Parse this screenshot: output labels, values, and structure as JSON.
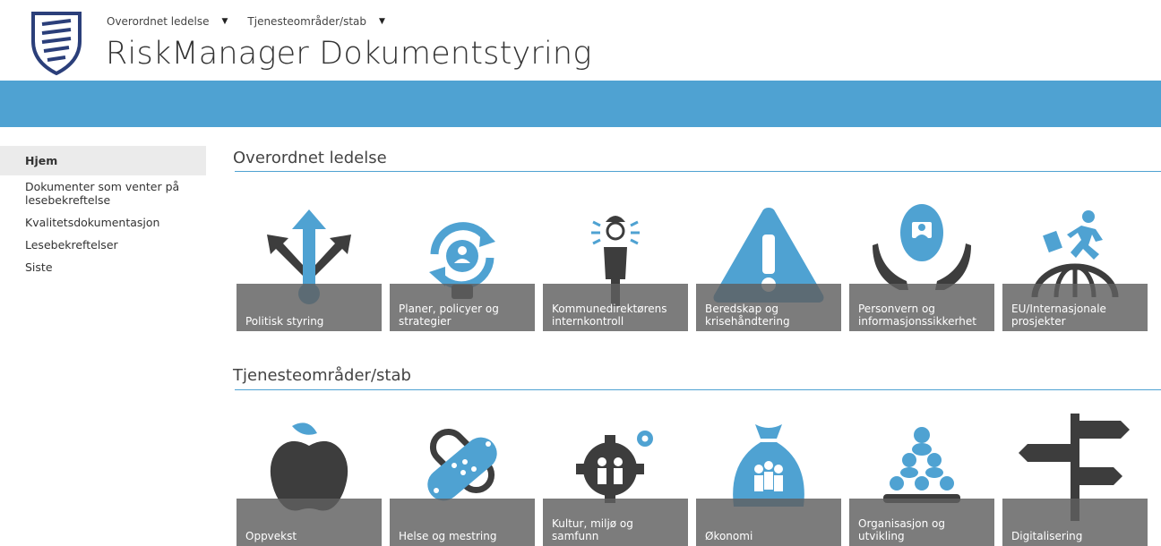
{
  "header": {
    "nav": [
      "Overordnet ledelse",
      "Tjenesteområder/stab"
    ],
    "title": "RiskManager Dokumentstyring"
  },
  "sidebar": {
    "items": [
      {
        "label": "Hjem",
        "active": true
      },
      {
        "label": "Dokumenter som venter på lesebekreftelse"
      },
      {
        "label": "Kvalitetsdokumentasjon"
      },
      {
        "label": "Lesebekreftelser"
      },
      {
        "label": "Siste"
      }
    ]
  },
  "sections": [
    {
      "title": "Overordnet ledelse",
      "tiles": [
        {
          "label": "Politisk styring",
          "icon": "arrows-directions-icon"
        },
        {
          "label": "Planer, policyer og strategier",
          "icon": "lightbulb-cycle-icon"
        },
        {
          "label": "Kommunedirektørens internkontroll",
          "icon": "spotlight-person-icon"
        },
        {
          "label": "Beredskap og krisehåndtering",
          "icon": "warning-triangle-icon"
        },
        {
          "label": "Personvern og informasjonssikkerhet",
          "icon": "hands-protect-person-icon"
        },
        {
          "label": "EU/Internasjonale prosjekter",
          "icon": "running-globe-icon"
        }
      ]
    },
    {
      "title": "Tjenesteområder/stab",
      "tiles": [
        {
          "label": "Oppvekst",
          "icon": "apple-icon"
        },
        {
          "label": "Helse og mestring",
          "icon": "bandage-icon"
        },
        {
          "label": "Kultur, miljø og samfunn",
          "icon": "gear-people-icon"
        },
        {
          "label": "Økonomi",
          "icon": "money-bag-people-icon"
        },
        {
          "label": "Organisasjon og utvikling",
          "icon": "people-pyramid-icon"
        },
        {
          "label": "Digitalisering",
          "icon": "signpost-icon"
        }
      ]
    }
  ],
  "colors": {
    "accent": "#4fa2d2",
    "icon_dark": "#3d3d3d",
    "caption_bg": "#5f5f5f"
  }
}
